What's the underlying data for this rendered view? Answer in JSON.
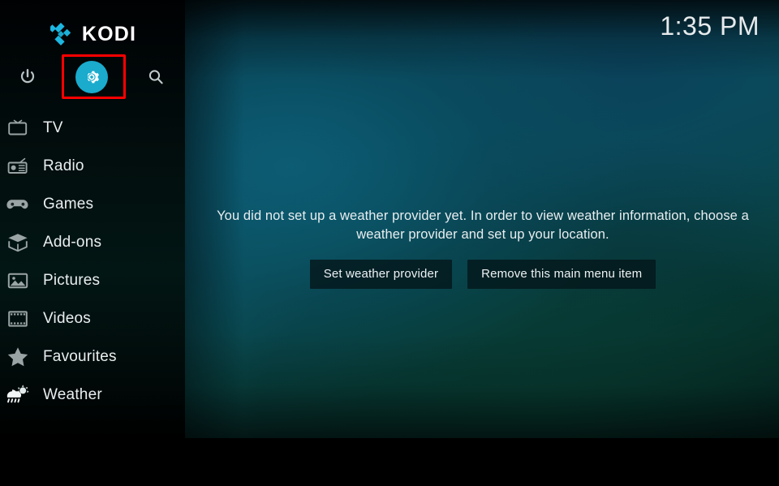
{
  "app": {
    "name": "Kodi",
    "logo_text": "KODI",
    "logo_icon": "kodi-diamond-logo"
  },
  "colors": {
    "accent": "#1aabcd",
    "highlight_box": "#ff0000",
    "text_primary": "#e9eef0",
    "background_dark": "#000000",
    "content_teal": "#0b5e6a"
  },
  "header": {
    "clock": "1:35 PM"
  },
  "sidebar": {
    "top_icons": [
      {
        "name": "power-icon",
        "label": "Power"
      },
      {
        "name": "settings-gear-icon",
        "label": "Settings",
        "selected": true
      },
      {
        "name": "search-icon",
        "label": "Search"
      }
    ],
    "items": [
      {
        "label": "TV",
        "icon": "tv-icon"
      },
      {
        "label": "Radio",
        "icon": "radio-icon"
      },
      {
        "label": "Games",
        "icon": "gamepad-icon"
      },
      {
        "label": "Add-ons",
        "icon": "addon-box-icon"
      },
      {
        "label": "Pictures",
        "icon": "picture-icon"
      },
      {
        "label": "Videos",
        "icon": "film-strip-icon"
      },
      {
        "label": "Favourites",
        "icon": "star-icon"
      },
      {
        "label": "Weather",
        "icon": "weather-cloud-sun-icon"
      }
    ]
  },
  "main": {
    "message": "You did not set up a weather provider yet. In order to view weather information, choose a weather provider and set up your location.",
    "buttons": [
      {
        "label": "Set weather provider",
        "name": "set-weather-provider-button"
      },
      {
        "label": "Remove this main menu item",
        "name": "remove-main-menu-item-button"
      }
    ]
  }
}
